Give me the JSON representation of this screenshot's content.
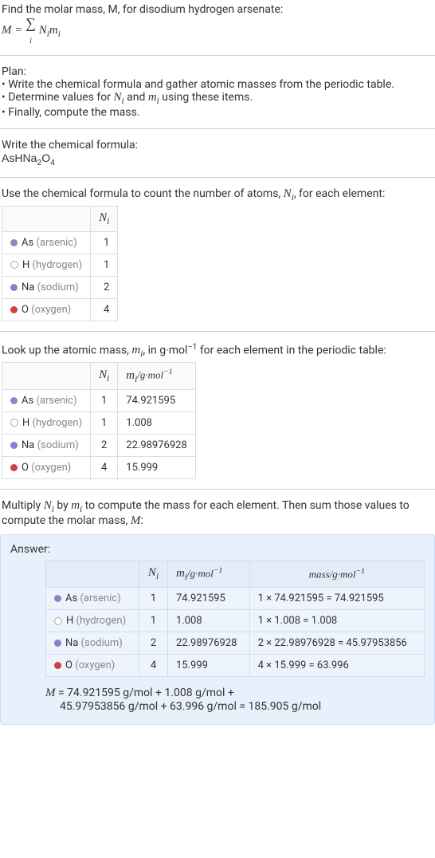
{
  "intro": {
    "line1": "Find the molar mass, M, for disodium hydrogen arsenate:",
    "formula_lhs": "M = ",
    "formula_rhs_desc": "∑ Nᵢmᵢ (sum over i)"
  },
  "plan": {
    "heading": "Plan:",
    "items": [
      "Write the chemical formula and gather atomic masses from the periodic table.",
      "Determine values for Nᵢ and mᵢ using these items.",
      "Finally, compute the mass."
    ]
  },
  "chem_formula": {
    "heading": "Write the chemical formula:",
    "formula_plain": "AsHNa2O4"
  },
  "count": {
    "heading": "Use the chemical formula to count the number of atoms, Nᵢ, for each element:",
    "col_N": "Nᵢ",
    "rows": [
      {
        "sym": "As",
        "name": "(arsenic)",
        "dot": "as",
        "N": "1"
      },
      {
        "sym": "H",
        "name": "(hydrogen)",
        "dot": "h",
        "N": "1"
      },
      {
        "sym": "Na",
        "name": "(sodium)",
        "dot": "na",
        "N": "2"
      },
      {
        "sym": "O",
        "name": "(oxygen)",
        "dot": "o",
        "N": "4"
      }
    ]
  },
  "masses": {
    "heading": "Look up the atomic mass, mᵢ, in g·mol⁻¹ for each element in the periodic table:",
    "col_N": "Nᵢ",
    "col_m": "mᵢ/g·mol⁻¹",
    "rows": [
      {
        "sym": "As",
        "name": "(arsenic)",
        "dot": "as",
        "N": "1",
        "m": "74.921595"
      },
      {
        "sym": "H",
        "name": "(hydrogen)",
        "dot": "h",
        "N": "1",
        "m": "1.008"
      },
      {
        "sym": "Na",
        "name": "(sodium)",
        "dot": "na",
        "N": "2",
        "m": "22.98976928"
      },
      {
        "sym": "O",
        "name": "(oxygen)",
        "dot": "o",
        "N": "4",
        "m": "15.999"
      }
    ]
  },
  "multiply": {
    "heading": "Multiply Nᵢ by mᵢ to compute the mass for each element. Then sum those values to compute the molar mass, M:"
  },
  "answer": {
    "label": "Answer:",
    "col_N": "Nᵢ",
    "col_m": "mᵢ/g·mol⁻¹",
    "col_mass": "mass/g·mol⁻¹",
    "rows": [
      {
        "sym": "As",
        "name": "(arsenic)",
        "dot": "as",
        "N": "1",
        "m": "74.921595",
        "mass": "1 × 74.921595 = 74.921595"
      },
      {
        "sym": "H",
        "name": "(hydrogen)",
        "dot": "h",
        "N": "1",
        "m": "1.008",
        "mass": "1 × 1.008 = 1.008"
      },
      {
        "sym": "Na",
        "name": "(sodium)",
        "dot": "na",
        "N": "2",
        "m": "22.98976928",
        "mass": "2 × 22.98976928 = 45.97953856"
      },
      {
        "sym": "O",
        "name": "(oxygen)",
        "dot": "o",
        "N": "4",
        "m": "15.999",
        "mass": "4 × 15.999 = 63.996"
      }
    ],
    "final_line1": "M = 74.921595 g/mol + 1.008 g/mol +",
    "final_line2": "45.97953856 g/mol + 63.996 g/mol = 185.905 g/mol"
  }
}
